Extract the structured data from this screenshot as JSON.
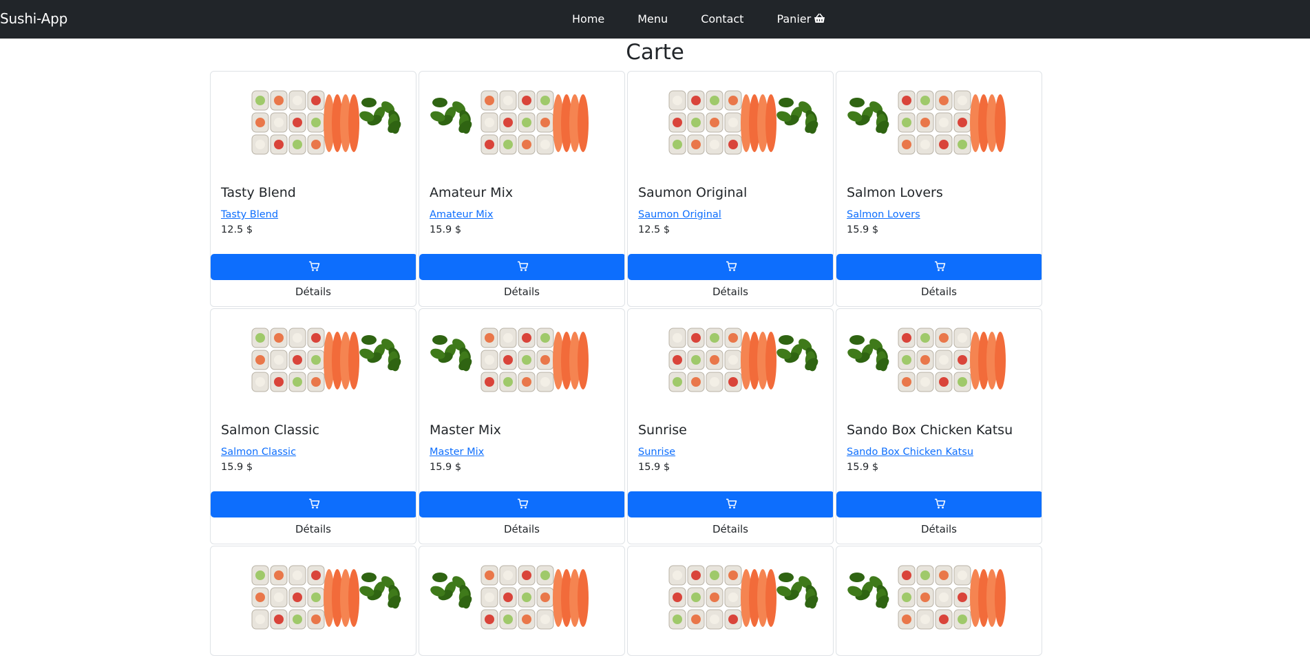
{
  "navbar": {
    "brand": "Sushi-App",
    "links": [
      "Home",
      "Menu",
      "Contact",
      "Panier"
    ],
    "basket_icon": "basket-icon"
  },
  "page": {
    "title": "Carte"
  },
  "card_actions": {
    "cart_icon": "cart-icon",
    "details_label": "Détails"
  },
  "colors": {
    "navbar_bg": "#212529",
    "primary": "#0d6efd"
  },
  "products": [
    {
      "name": "Tasty Blend",
      "link": "Tasty Blend",
      "price": "12.5  $"
    },
    {
      "name": "Amateur Mix",
      "link": "Amateur Mix",
      "price": "15.9  $"
    },
    {
      "name": "Saumon Original",
      "link": "Saumon Original",
      "price": "12.5  $"
    },
    {
      "name": "Salmon Lovers",
      "link": "Salmon Lovers",
      "price": "15.9  $"
    },
    {
      "name": "Salmon Classic",
      "link": "Salmon Classic",
      "price": "15.9  $"
    },
    {
      "name": "Master Mix",
      "link": "Master Mix",
      "price": "15.9  $"
    },
    {
      "name": "Sunrise",
      "link": "Sunrise",
      "price": "15.9  $"
    },
    {
      "name": "Sando Box Chicken Katsu",
      "link": "Sando Box Chicken Katsu",
      "price": "15.9  $"
    }
  ]
}
